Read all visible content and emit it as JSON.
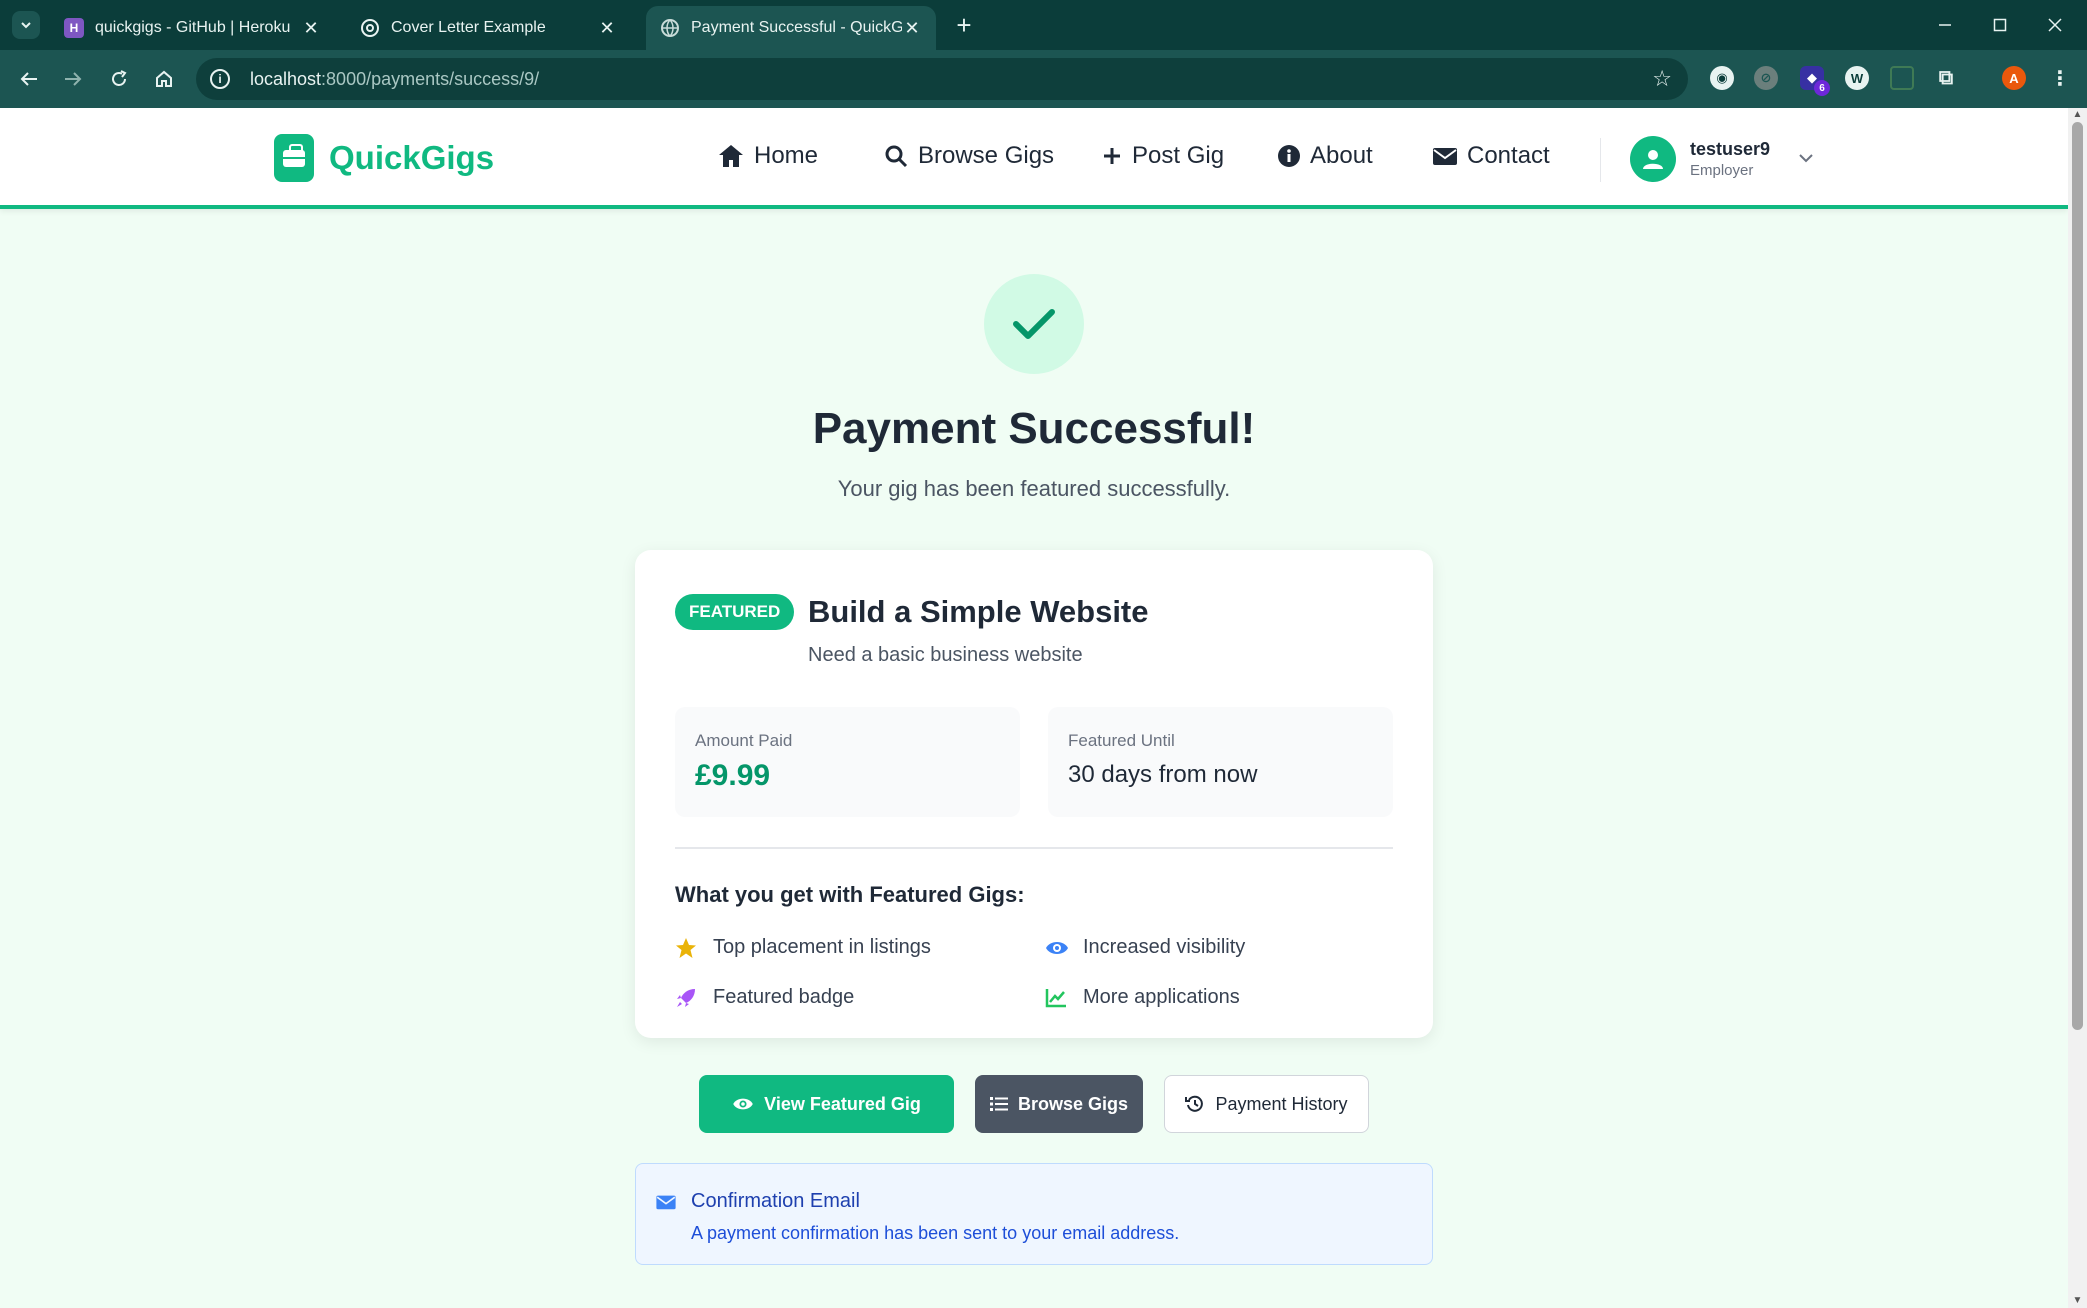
{
  "browser": {
    "tabs": [
      {
        "title": "quickgigs - GitHub | Heroku",
        "favicon": "H"
      },
      {
        "title": "Cover Letter Example",
        "favicon": "gpt"
      },
      {
        "title": "Payment Successful - QuickGigs",
        "favicon": "globe"
      }
    ],
    "url_host": "localhost",
    "url_path": ":8000/payments/success/9/",
    "profile_initial": "A",
    "extension_badge": "6"
  },
  "site": {
    "logo_text": "QuickGigs",
    "nav": [
      {
        "label": "Home",
        "icon": "home-icon"
      },
      {
        "label": "Browse Gigs",
        "icon": "search-icon"
      },
      {
        "label": "Post Gig",
        "icon": "plus-icon"
      },
      {
        "label": "About",
        "icon": "info-icon"
      },
      {
        "label": "Contact",
        "icon": "envelope-icon"
      }
    ],
    "user": {
      "name": "testuser9",
      "role": "Employer"
    }
  },
  "hero": {
    "title": "Payment Successful!",
    "subtitle": "Your gig has been featured successfully."
  },
  "gig_card": {
    "badge": "FEATURED",
    "title": "Build a Simple Website",
    "description": "Need a basic business website",
    "amount_label": "Amount Paid",
    "amount_value": "£9.99",
    "until_label": "Featured Until",
    "until_value": "30 days from now",
    "benefits_title": "What you get with Featured Gigs:",
    "benefits": [
      {
        "label": "Top placement in listings",
        "icon": "star-icon"
      },
      {
        "label": "Increased visibility",
        "icon": "eye-icon"
      },
      {
        "label": "Featured badge",
        "icon": "rocket-icon"
      },
      {
        "label": "More applications",
        "icon": "chart-line-icon"
      }
    ]
  },
  "actions": {
    "view_featured": "View Featured Gig",
    "browse_gigs": "Browse Gigs",
    "payment_history": "Payment History"
  },
  "email_notice": {
    "title": "Confirmation Email",
    "text": "A payment confirmation has been sent to your email address."
  },
  "colors": {
    "brand": "#10b981",
    "page_bg": "#f0fdf4",
    "chrome": "#0b3d3a",
    "info_blue": "#1e40af"
  }
}
